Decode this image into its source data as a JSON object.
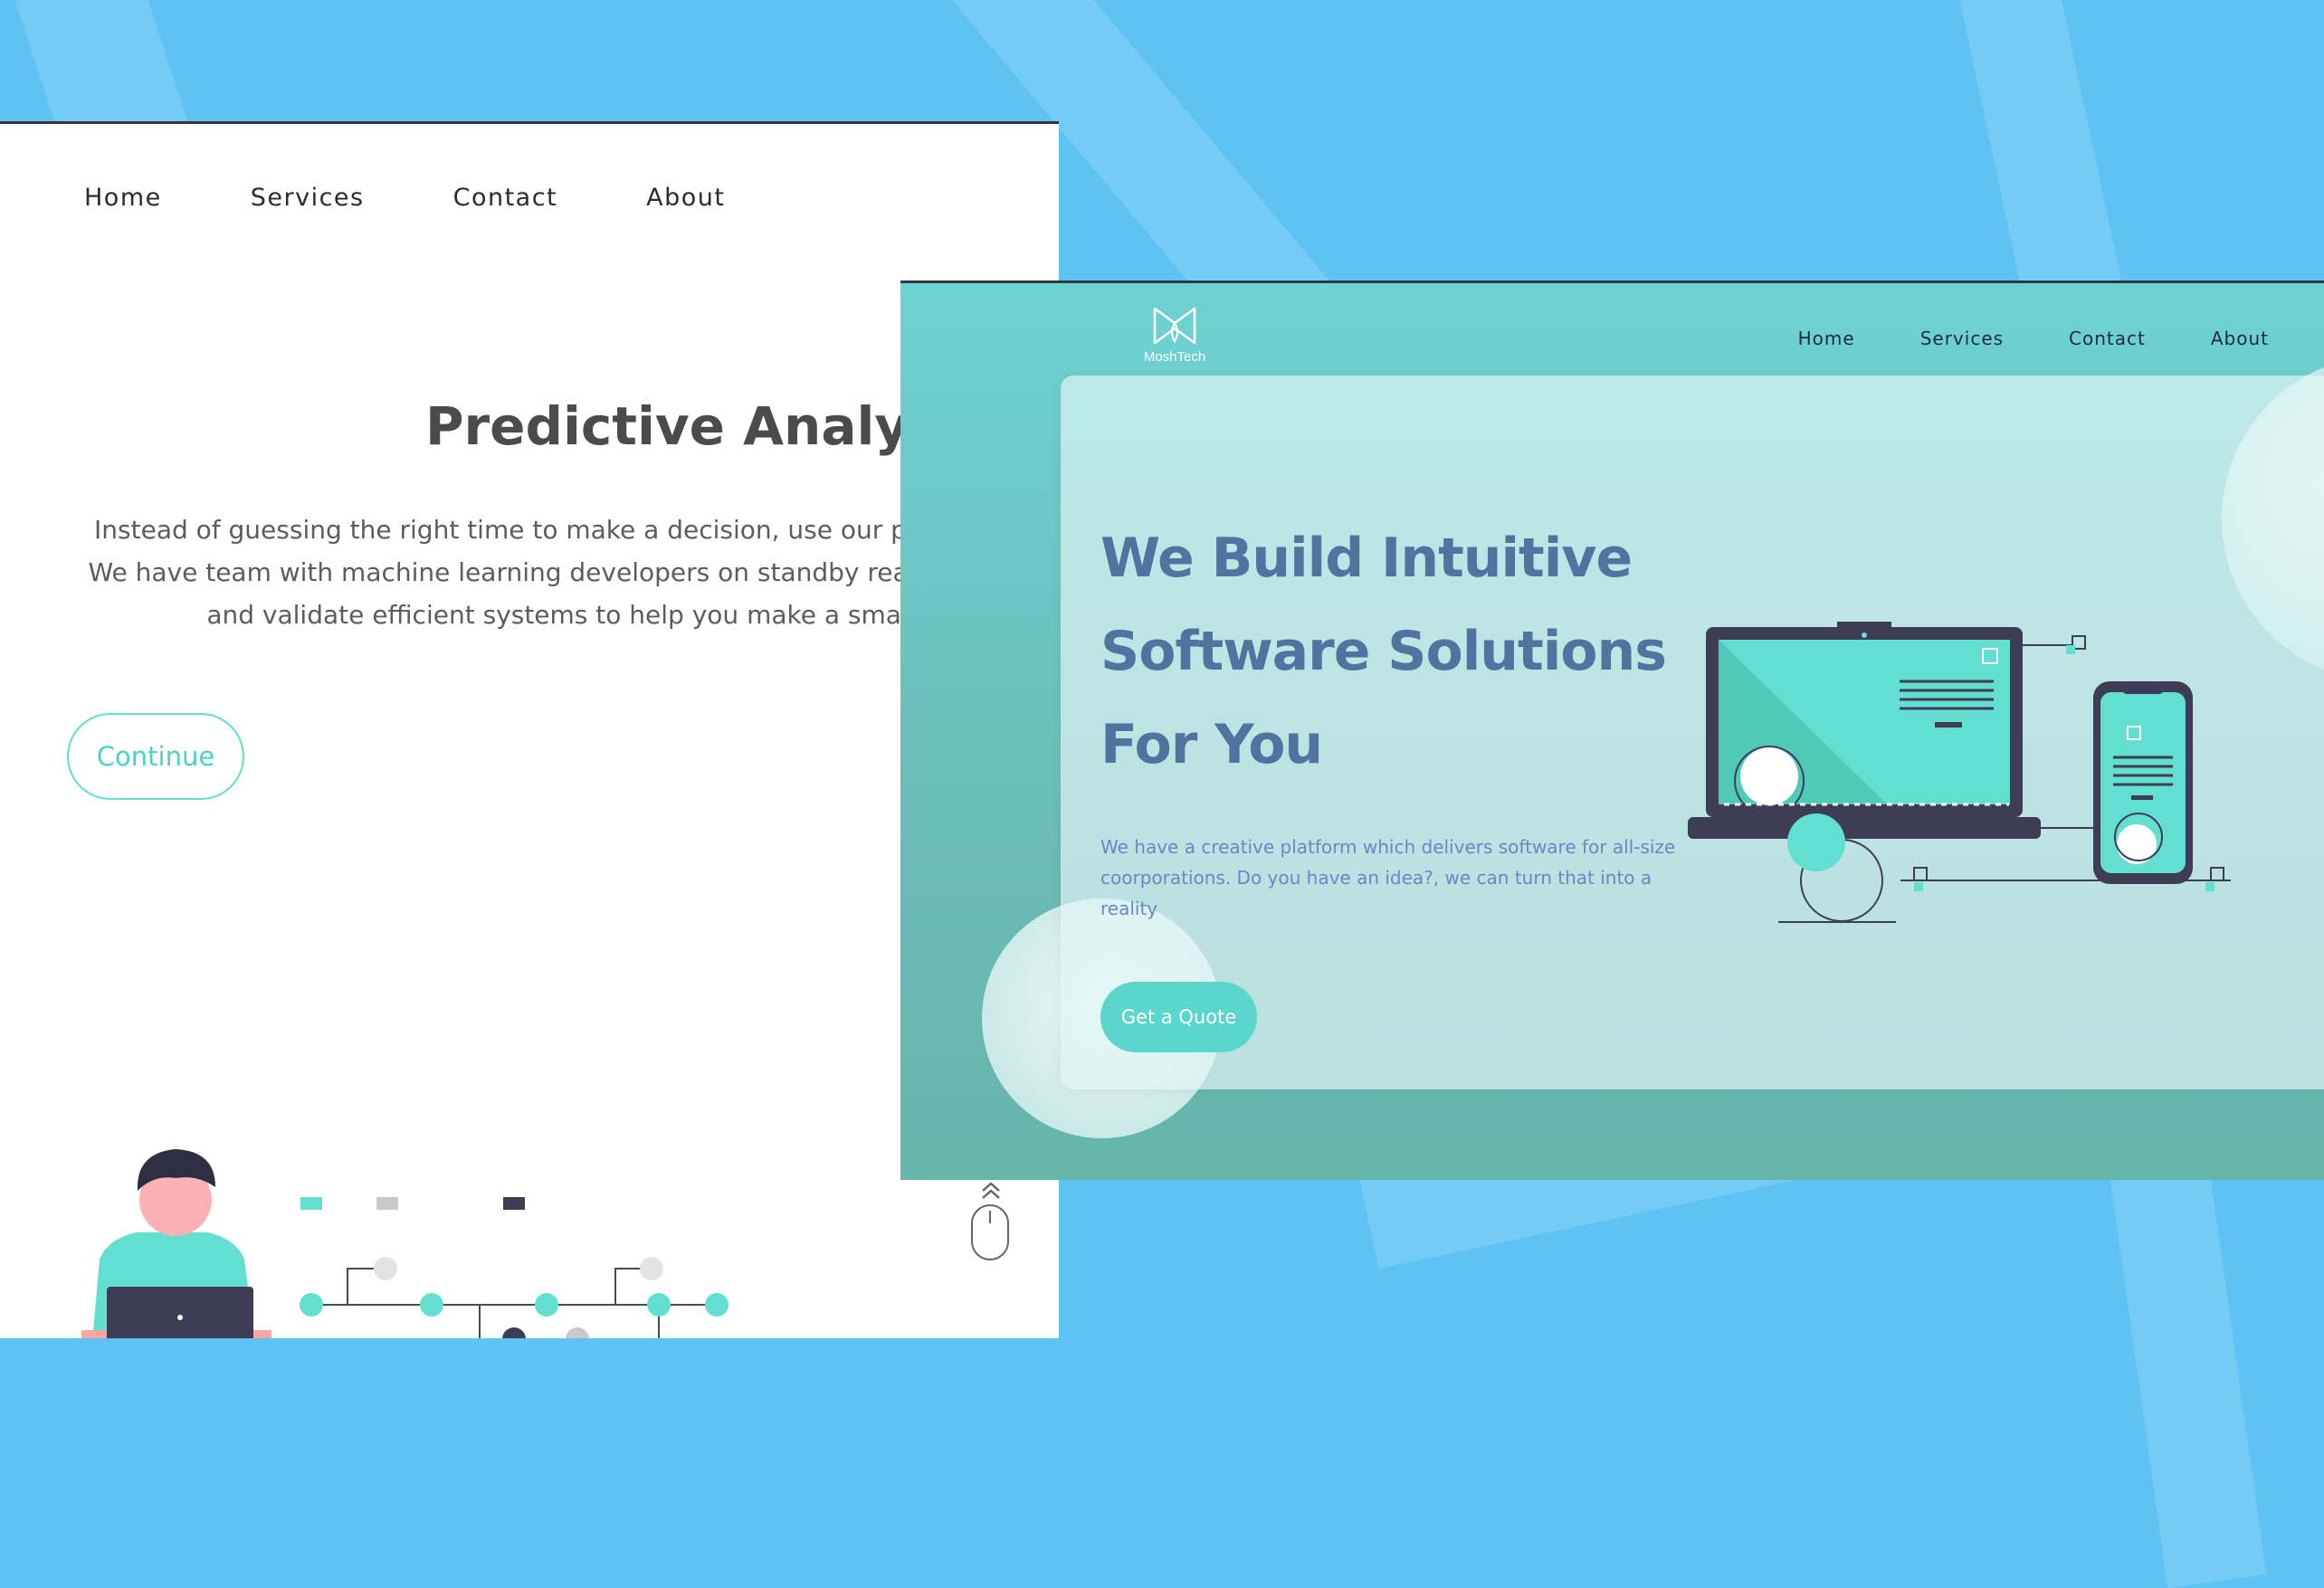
{
  "colors": {
    "background": "#5ec3f3",
    "accent_teal": "#62dfd1",
    "hero_blue": "#4f74a0",
    "paragraph_blue": "#6889c6",
    "dark_navy": "#3f3d56"
  },
  "left_window": {
    "nav": [
      "Home",
      "Services",
      "Contact",
      "About"
    ],
    "title": "Predictive Analytics",
    "paragraph": "Instead of guessing the right time to make a decision, use our predective analytics. We have team with machine learning developers on standby ready to help you build and validate efficient systems to help you make a smart decision.",
    "continue_label": "Continue",
    "icons": [
      "person-laptop-illustration",
      "flow-diagram-illustration",
      "mouse-scroll-icon",
      "chevron-up-icon"
    ]
  },
  "right_window": {
    "logo_text": "MoshTech",
    "logo_icon": "bow-logo-icon",
    "nav": [
      "Home",
      "Services",
      "Contact",
      "About"
    ],
    "hero_lines": [
      "We Build Intuitive",
      "Software Solutions",
      "For You"
    ],
    "paragraph_lines": [
      "We have a creative platform which delivers software for all-size",
      "coorporations. Do you have an idea?, we can turn that into a",
      "reality"
    ],
    "cta_label": "Get a Quote",
    "illustration": "laptop-phone-illustration"
  }
}
